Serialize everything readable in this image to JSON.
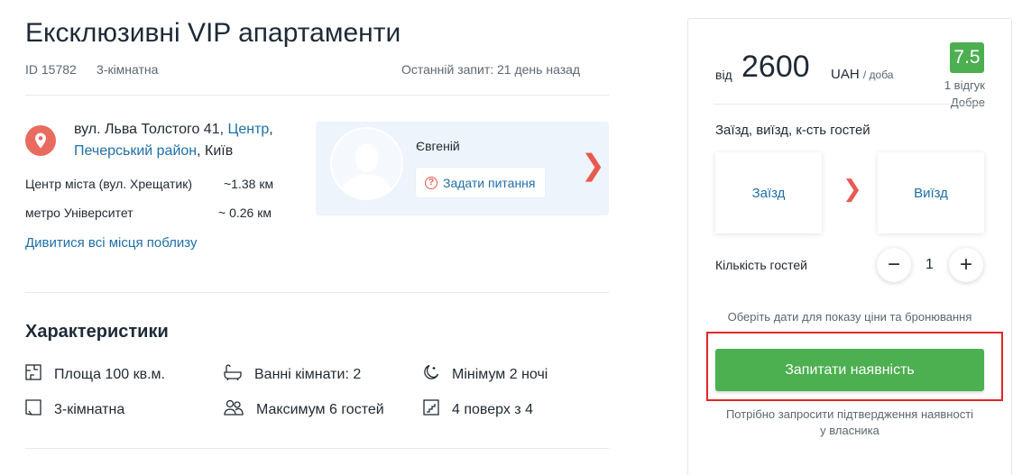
{
  "listing": {
    "title": "Ексклюзивні VIP апартаменти",
    "id_label": "ID 15782",
    "rooms_link": "3-кімнатна",
    "last_request": "Останній запит: 21 день назад"
  },
  "location": {
    "street": "вул. Льва Толстого 41, ",
    "center_link": "Центр",
    "comma": ",",
    "district_link": "Печерський район",
    "city": ", Київ",
    "distances": [
      {
        "label": "Центр міста (вул. Хрещатик)",
        "value": "~1.38 км"
      },
      {
        "label": "метро Університет",
        "value": "~ 0.26 км"
      }
    ],
    "nearby_link": "Дивитися всі місця поблизу"
  },
  "host": {
    "name": "Євгеній",
    "ask_button": "Задати питання",
    "next_icon": "chevron-right-icon"
  },
  "features": {
    "title": "Характеристики",
    "items": [
      {
        "icon": "floor-plan-icon",
        "label": "Площа 100 кв.м."
      },
      {
        "icon": "bathtub-icon",
        "label": "Ванні кімнати: 2"
      },
      {
        "icon": "moon-night-icon",
        "label": "Мінімум 2 ночі"
      },
      {
        "icon": "room-icon",
        "label": "3-кімнатна"
      },
      {
        "icon": "guests-icon",
        "label": "Максимум 6 гостей"
      },
      {
        "icon": "stairs-icon",
        "label": "4 поверх з 4"
      }
    ]
  },
  "booking": {
    "from": "від",
    "price": "2600",
    "currency": "UAH",
    "per": "/ доба",
    "rating": "7.5",
    "reviews": "1 відгук",
    "rating_word": "Добре",
    "stay_label": "Заїзд, виїзд, к-сть гостей",
    "checkin": "Заїзд",
    "checkout": "Виїзд",
    "guests_label": "Кількість гостей",
    "guests_count": "1",
    "minus": "−",
    "plus": "+",
    "hint": "Оберіть дати для показу ціни та бронювання",
    "cta": "Запитати наявність",
    "note_line1": "Потрібно запросити підтвердження наявності",
    "note_line2": "у власника",
    "colors": {
      "accent": "#4caf50",
      "link": "#1f6fa8",
      "highlight": "#e0262a"
    }
  }
}
